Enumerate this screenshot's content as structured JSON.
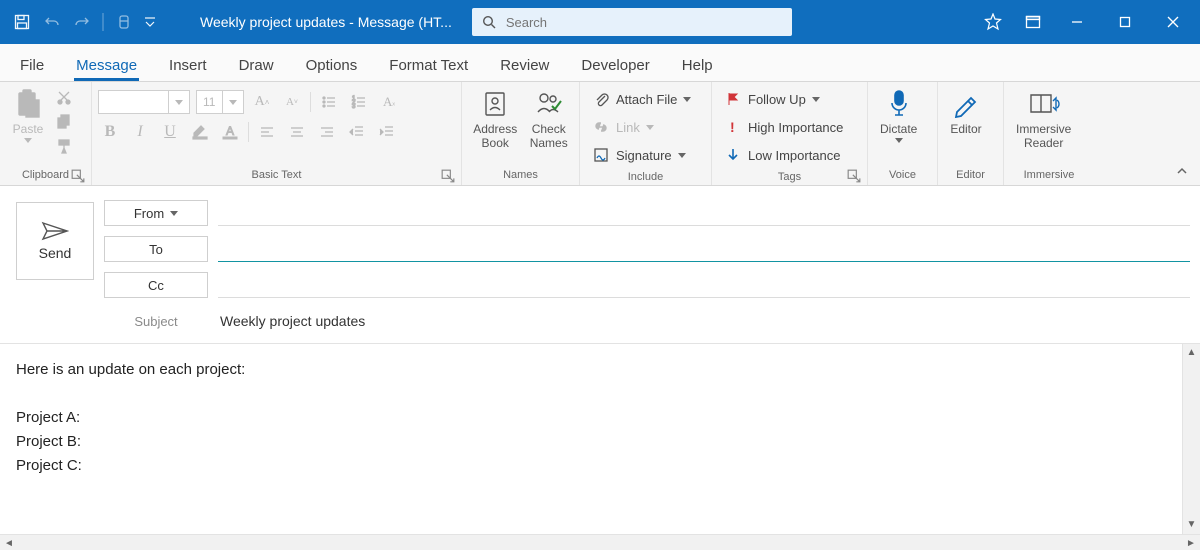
{
  "titlebar": {
    "title": "Weekly project updates  -  Message (HT...",
    "search_placeholder": "Search"
  },
  "tabs": [
    "File",
    "Message",
    "Insert",
    "Draw",
    "Options",
    "Format Text",
    "Review",
    "Developer",
    "Help"
  ],
  "active_tab": "Message",
  "ribbon": {
    "clipboard": {
      "paste": "Paste",
      "label": "Clipboard"
    },
    "basictext": {
      "font_name": "",
      "font_size": "11",
      "label": "Basic Text"
    },
    "names": {
      "address_book": "Address\nBook",
      "check_names": "Check\nNames",
      "label": "Names"
    },
    "include": {
      "attach_file": "Attach File",
      "link": "Link",
      "signature": "Signature",
      "label": "Include"
    },
    "tags": {
      "follow_up": "Follow Up",
      "high": "High Importance",
      "low": "Low Importance",
      "label": "Tags"
    },
    "voice": {
      "dictate": "Dictate",
      "label": "Voice"
    },
    "editor": {
      "editor": "Editor",
      "label": "Editor"
    },
    "immersive": {
      "reader": "Immersive\nReader",
      "label": "Immersive"
    }
  },
  "compose": {
    "send": "Send",
    "from": "From",
    "to": "To",
    "cc": "Cc",
    "subject_label": "Subject",
    "subject_value": "Weekly project updates",
    "from_value": "",
    "to_value": "",
    "cc_value": ""
  },
  "body_lines": [
    "Here is an update on each project:",
    "",
    "Project A:",
    "Project B:",
    "Project C:"
  ]
}
